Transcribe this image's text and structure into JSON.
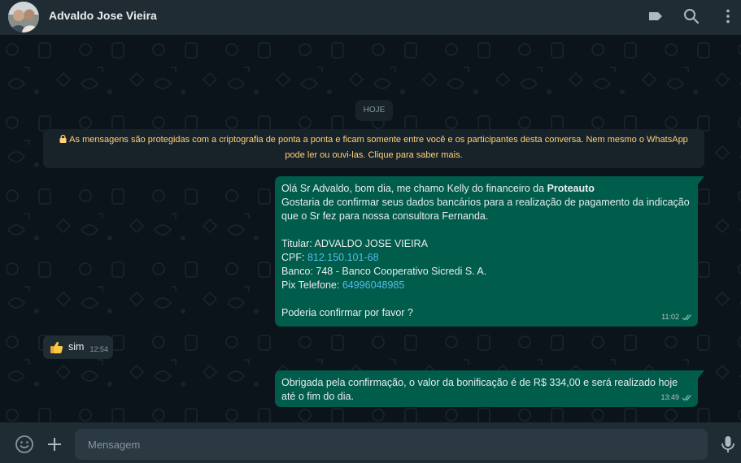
{
  "header": {
    "contact_name": "Advaldo Jose Vieira",
    "icons": [
      "avatar",
      "label-icon",
      "search-icon",
      "menu-dots-icon"
    ]
  },
  "chat": {
    "date_label": "HOJE",
    "encryption_notice": "As mensagens são protegidas com a criptografia de ponta a ponta e ficam somente entre você e os participantes desta conversa. Nem mesmo o WhatsApp pode ler ou ouvi-las. Clique para saber mais.",
    "messages": [
      {
        "direction": "outgoing",
        "time": "11:02",
        "status": "read",
        "greeting_prefix": "Olá Sr Advaldo, bom dia, me chamo Kelly do financeiro da ",
        "greeting_bold": "Proteauto",
        "line2": "Gostaria de confirmar seus dados bancários para a realização de pagamento da indicação que o Sr fez para nossa consultora Fernanda.",
        "titular": "Titular: ADVALDO JOSE VIEIRA",
        "cpf_label": "CPF: ",
        "cpf_value": "812.150.101-68",
        "banco": "Banco: 748 - Banco Cooperativo Sicredi S. A.",
        "pix_label": "Pix Telefone: ",
        "pix_value": "64996048985",
        "closing": "Poderia confirmar por favor ?"
      },
      {
        "direction": "incoming",
        "time": "12:54",
        "emoji": "thumbs-up-icon",
        "text": "sim"
      },
      {
        "direction": "outgoing",
        "time": "13:49",
        "status": "read",
        "text": "Obrigada pela confirmação, o valor da bonificação é de R$ 334,00 e será realizado hoje até o fim do dia."
      }
    ]
  },
  "footer": {
    "placeholder": "Mensagem",
    "icons": [
      "emoji-icon",
      "attach-plus-icon",
      "mic-icon"
    ]
  },
  "colors": {
    "chat_bg": "#0b141a",
    "header_bg": "#202c33",
    "outgoing_bubble": "#005c4b",
    "incoming_bubble": "#202c33",
    "link": "#53bdeb",
    "notice_text": "#ffd279"
  }
}
